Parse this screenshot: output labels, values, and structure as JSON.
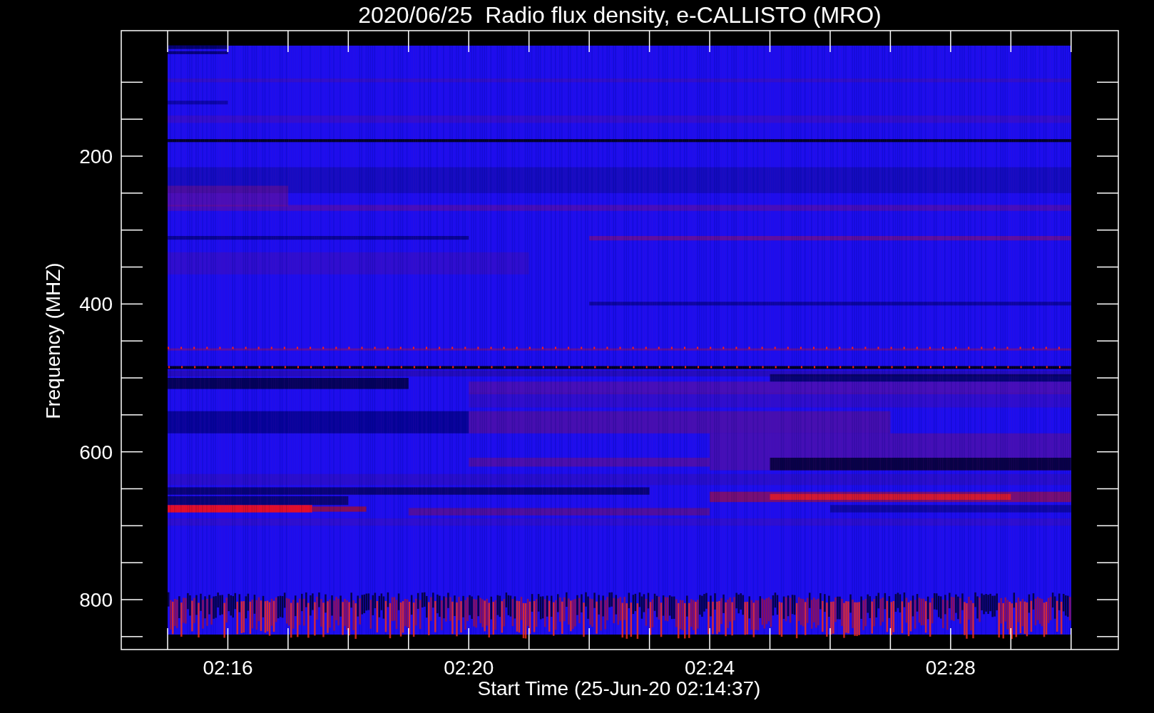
{
  "title": "2020/06/25  Radio flux density, e-CALLISTO (MRO)",
  "ylabel": "Frequency (MHZ)",
  "xlabel": "Start Time (25-Jun-20 02:14:37)",
  "yticks": [
    "200",
    "400",
    "600",
    "800"
  ],
  "xticks": [
    "02:16",
    "02:20",
    "02:24",
    "02:28"
  ]
}
